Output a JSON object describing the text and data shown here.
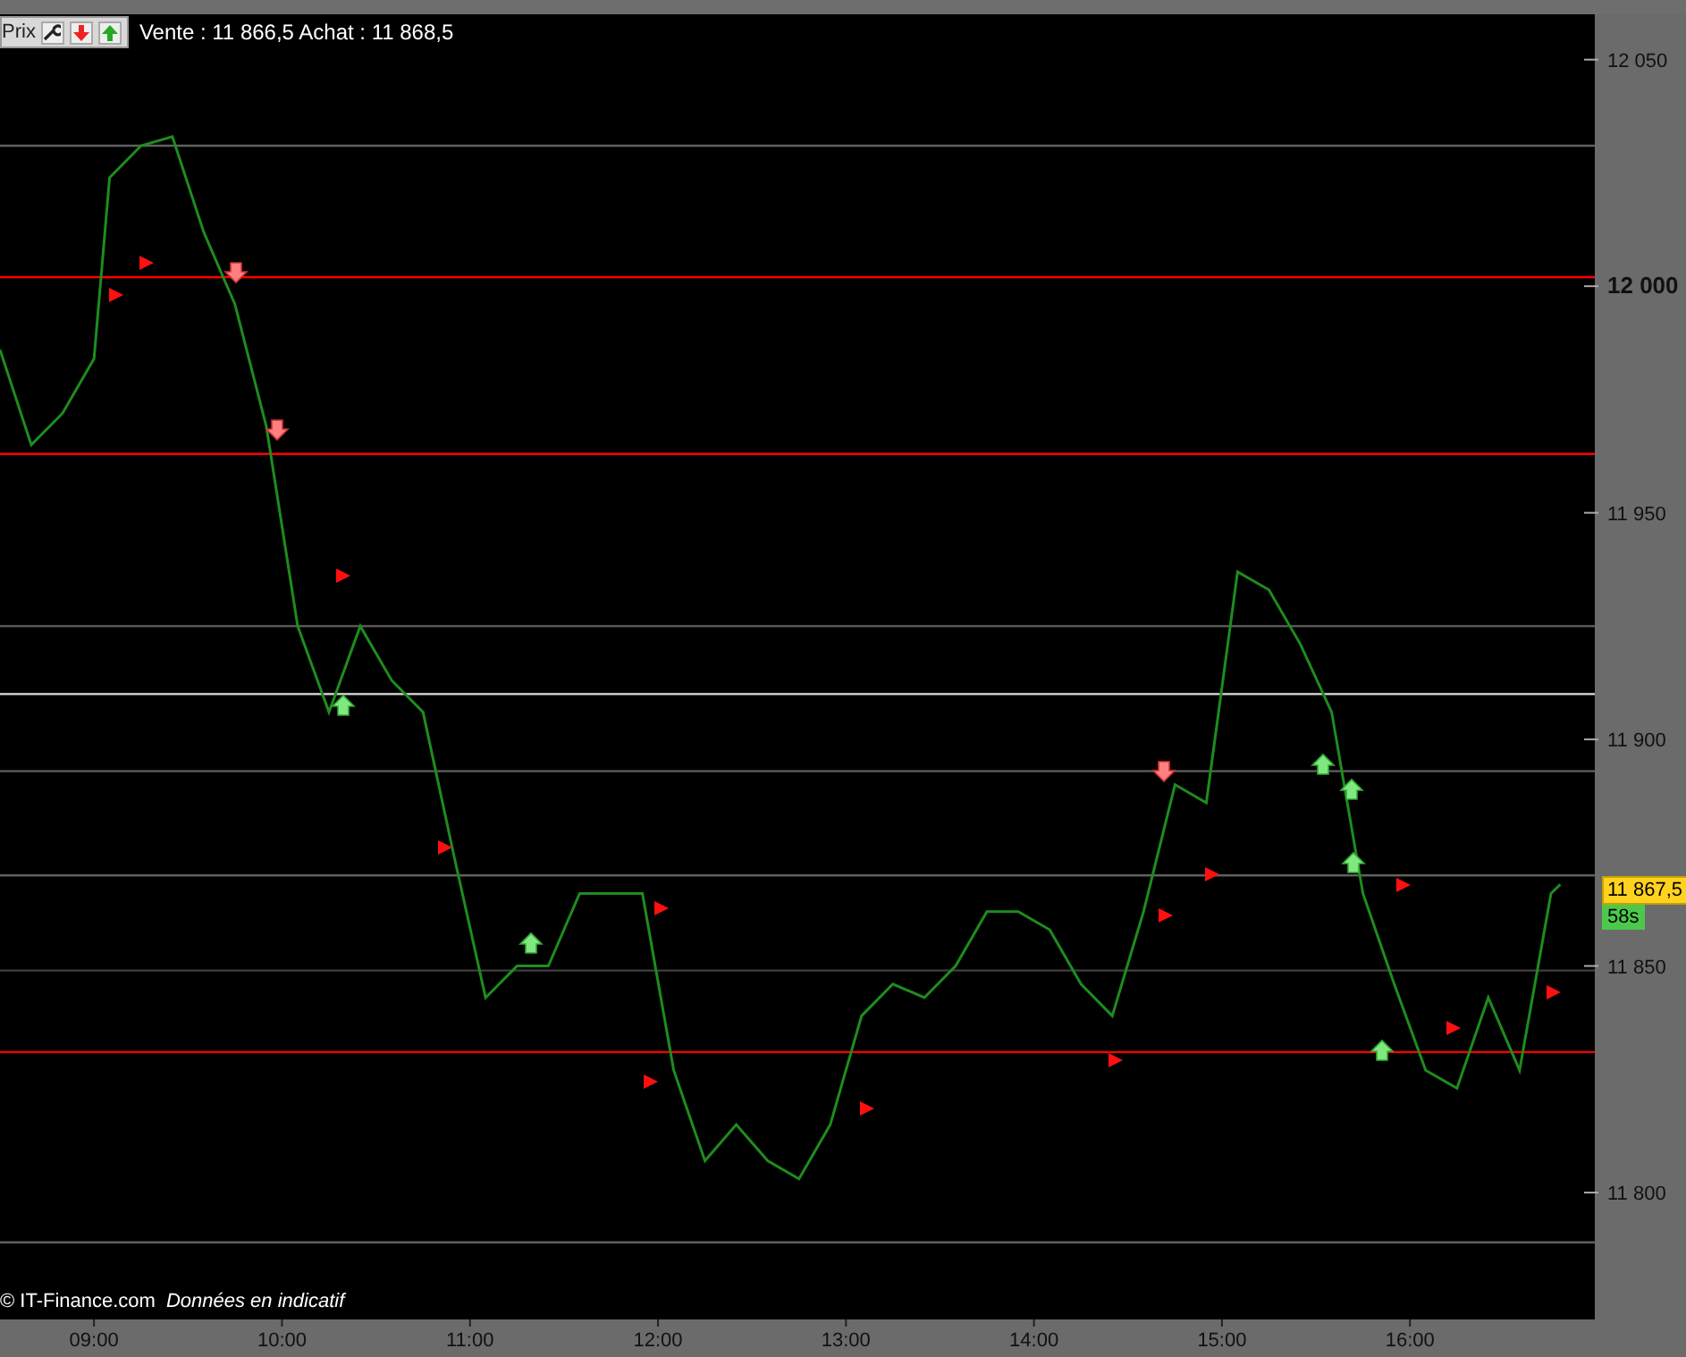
{
  "toolbar": {
    "quote": "Vente : 11 866,5 Achat : 11 868,5"
  },
  "chart_data": {
    "type": "line",
    "xlim": [
      510,
      1019
    ],
    "ylim": [
      11772,
      12060
    ],
    "ref_lines": [
      {
        "axis": "y",
        "value": 12002,
        "color": "#ff0000"
      },
      {
        "axis": "y",
        "value": 11963,
        "color": "#ff0000"
      },
      {
        "axis": "y",
        "value": 11831,
        "color": "#ff0000"
      },
      {
        "axis": "y",
        "value": 12031,
        "color": "#606060"
      },
      {
        "axis": "y",
        "value": 11925,
        "color": "#606060"
      },
      {
        "axis": "y",
        "value": 11910,
        "color": "#e0e0e0"
      },
      {
        "axis": "y",
        "value": 11893,
        "color": "#606060"
      },
      {
        "axis": "y",
        "value": 11870,
        "color": "#606060"
      },
      {
        "axis": "y",
        "value": 11849,
        "color": "#404040"
      },
      {
        "axis": "y",
        "value": 11789,
        "color": "#606060"
      }
    ],
    "yticks": [
      {
        "value": 11800,
        "label": "11 800"
      },
      {
        "value": 11850,
        "label": "11 850"
      },
      {
        "value": 11900,
        "label": "11 900"
      },
      {
        "value": 11950,
        "label": "11 950"
      },
      {
        "value": 12000,
        "label": "12 000"
      },
      {
        "value": 12050,
        "label": "12 050"
      }
    ],
    "xticks": [
      {
        "value": 540,
        "label": "09:00"
      },
      {
        "value": 600,
        "label": "10:00"
      },
      {
        "value": 660,
        "label": "11:00"
      },
      {
        "value": 720,
        "label": "12:00"
      },
      {
        "value": 780,
        "label": "13:00"
      },
      {
        "value": 840,
        "label": "14:00"
      },
      {
        "value": 900,
        "label": "15:00"
      },
      {
        "value": 960,
        "label": "16:00"
      }
    ],
    "x": [
      510,
      520,
      530,
      540,
      545,
      555,
      565,
      575,
      585,
      595,
      605,
      615,
      625,
      635,
      645,
      655,
      665,
      675,
      685,
      695,
      705,
      715,
      725,
      735,
      745,
      755,
      765,
      775,
      785,
      795,
      805,
      815,
      825,
      835,
      845,
      855,
      865,
      875,
      885,
      895,
      905,
      915,
      925,
      935,
      945,
      955,
      965,
      975,
      985,
      995,
      1005,
      1008
    ],
    "series": [
      {
        "name": "Prix",
        "color": "#1e8c1e",
        "values": [
          11986,
          11965,
          11972,
          11984,
          12024,
          12031,
          12033,
          12012,
          11996,
          11969,
          11925,
          11906,
          11925,
          11913,
          11906,
          11874,
          11843,
          11850,
          11850,
          11866,
          11866,
          11866,
          11827,
          11807,
          11815,
          11807,
          11803,
          11815,
          11839,
          11846,
          11843,
          11850,
          11862,
          11862,
          11858,
          11846,
          11839,
          11862,
          11890,
          11886,
          11937,
          11933,
          11921,
          11906,
          11866,
          11846,
          11827,
          11823,
          11843,
          11827,
          11866,
          11868
        ]
      }
    ]
  },
  "last_price": {
    "value": "11 867,5",
    "timer": "58s"
  },
  "footer": {
    "copyright": "© IT-Finance.com",
    "note": "Données en indicatif"
  }
}
